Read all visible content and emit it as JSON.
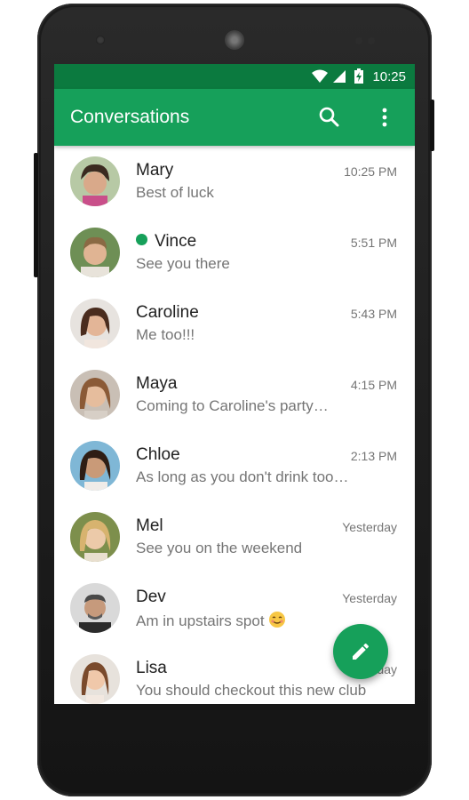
{
  "status_bar": {
    "time": "10:25",
    "icons": [
      "wifi-icon",
      "signal-icon",
      "battery-charging-icon"
    ]
  },
  "app_bar": {
    "title": "Conversations",
    "actions": [
      "search-icon",
      "more-vertical-icon"
    ]
  },
  "conversations": [
    {
      "name": "Mary",
      "message": "Best of luck",
      "time": "10:25 PM",
      "online": false
    },
    {
      "name": "Vince",
      "message": "See you there",
      "time": "5:51 PM",
      "online": true
    },
    {
      "name": "Caroline",
      "message": "Me too!!!",
      "time": "5:43 PM",
      "online": false
    },
    {
      "name": "Maya",
      "message": "Coming to Caroline's party…",
      "time": "4:15 PM",
      "online": false
    },
    {
      "name": "Chloe",
      "message": "As long as you don't drink too…",
      "time": "2:13 PM",
      "online": false
    },
    {
      "name": "Mel",
      "message": "See you on the weekend",
      "time": "Yesterday",
      "online": false
    },
    {
      "name": "Dev",
      "message": "Am in upstairs spot",
      "time": "Yesterday",
      "online": false,
      "emoji": "smiling-face-emoji"
    },
    {
      "name": "Lisa",
      "message": "You should checkout this new club",
      "time": "Yesterday",
      "online": false
    }
  ],
  "fab": {
    "icon": "pencil-icon"
  },
  "colors": {
    "primary": "#16a05a",
    "primary_dark": "#0b7a3f",
    "online": "#16a05a",
    "text_primary": "#212121",
    "text_secondary": "#757575"
  }
}
